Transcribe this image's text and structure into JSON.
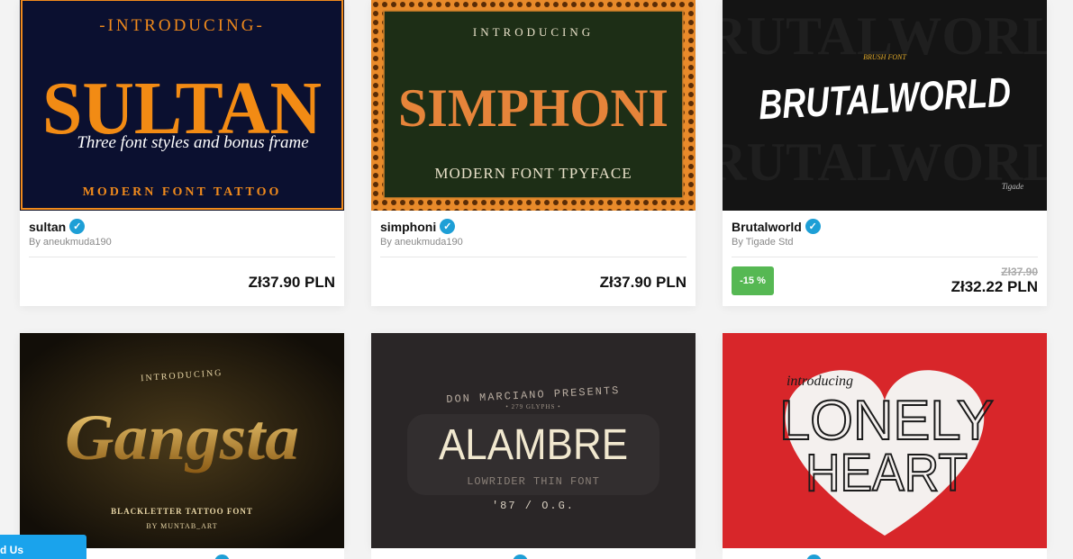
{
  "cards": [
    {
      "title": "sultan",
      "author": "By aneukmuda190",
      "price": "Zł37.90 PLN",
      "art": {
        "top": "-INTRODUCING-",
        "main": "SULTAN",
        "script": "Three font styles and bonus frame",
        "bottom": "MODERN FONT TATTOO"
      }
    },
    {
      "title": "simphoni",
      "author": "By aneukmuda190",
      "price": "Zł37.90 PLN",
      "art": {
        "top": "INTRODUCING",
        "main": "SIMPHONI",
        "bottom": "MODERN FONT TPYFACE"
      }
    },
    {
      "title": "Brutalworld",
      "author": "By Tigade Std",
      "price_old": "Zł37.90",
      "price": "Zł32.22 PLN",
      "discount": "-15 %",
      "art": {
        "small": "BRUSH FONT",
        "main": "BRUTALWORLD",
        "brand": "Tigade"
      }
    },
    {
      "art": {
        "top": "INTRODUCING",
        "main": "Gangsta",
        "sub1": "BLACKLETTER TATTOO FONT",
        "sub2": "BY MUNTAB_ART"
      }
    },
    {
      "art": {
        "top": "DON MARCIANO PRESENTS",
        "glyphs": "• 279 GLYPHS •",
        "main": "ALAMBRE",
        "sub": "LOWRIDER THIN FONT",
        "year": "'87 / O.G."
      }
    },
    {
      "art": {
        "top": "introducing",
        "main1": "LONELY",
        "main2": "HEART"
      }
    }
  ],
  "contact_label": "d Us",
  "colors": {
    "accent_blue": "#1e9fd6",
    "discount_green": "#56b853",
    "orange": "#f08a1c"
  }
}
